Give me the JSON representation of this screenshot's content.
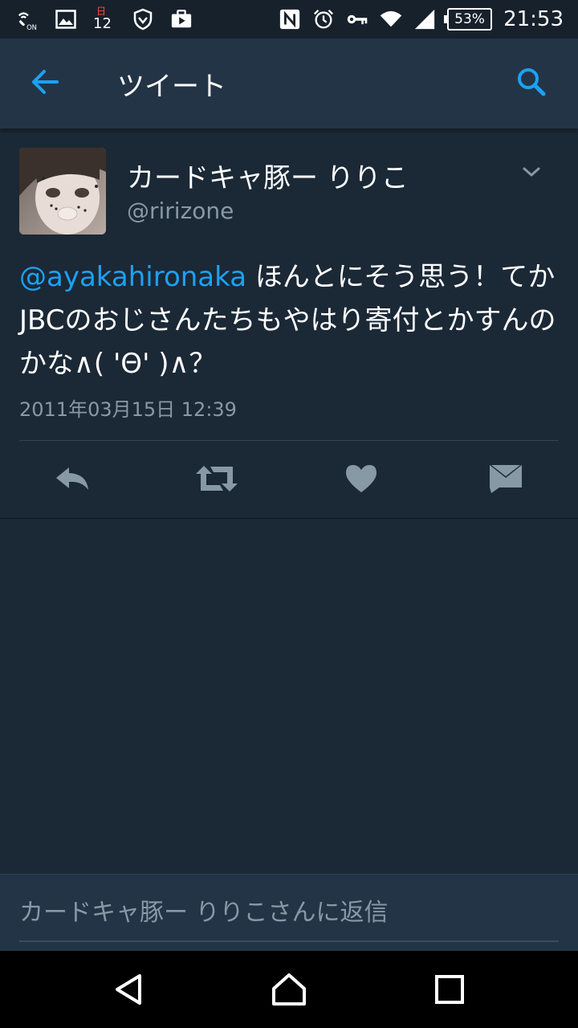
{
  "status_bar": {
    "calendar_day_label": "日",
    "calendar_day_number": "12",
    "battery_percent": "53%",
    "time": "21:53",
    "icons": [
      "wifi-calling-on-icon",
      "image-icon",
      "calendar-icon",
      "shield-icon",
      "briefcase-play-icon",
      "nfc-icon",
      "alarm-clock-icon",
      "key-icon",
      "wifi-icon",
      "signal-icon",
      "battery-icon"
    ]
  },
  "app_bar": {
    "title": "ツイート",
    "back_icon": "arrow-left-icon",
    "search_icon": "search-icon"
  },
  "tweet": {
    "display_name": "カードキャ豚ー りりこ",
    "handle": "@ririzone",
    "mention": "@ayakahironaka",
    "text": " ほんとにそう思う！てかJBCのおじさんたちもやはり寄付とかすんのかな∧( 'Θ' )∧？",
    "timestamp": "2011年03月15日 12:39",
    "actions": [
      "reply-icon",
      "retweet-icon",
      "heart-icon",
      "direct-message-icon"
    ]
  },
  "reply_bar": {
    "placeholder": "カードキャ豚ー りりこさんに返信"
  },
  "colors": {
    "background": "#1b2836",
    "app_bar": "#243447",
    "accent": "#1da1f2",
    "secondary_text": "#8899a6",
    "icon_gray": "#8899a6"
  }
}
